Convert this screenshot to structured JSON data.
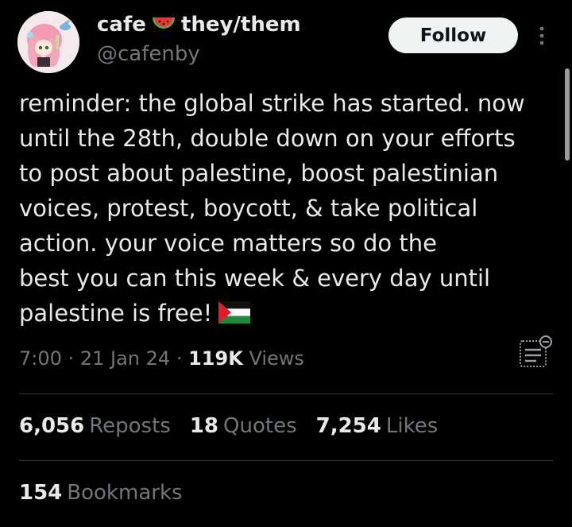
{
  "author": {
    "name": "cafe",
    "name_emoji": "watermelon-icon",
    "pronouns": "they/them",
    "handle": "@cafenby"
  },
  "follow_button": {
    "label": "Follow"
  },
  "tweet": {
    "lines": [
      "reminder: the global strike has started. now",
      "until the 28th, double down on your efforts",
      "to post about palestine, boost palestinian",
      "voices, protest, boycott, & take political",
      "action. your voice matters so do the",
      "best you can this week & every day until",
      "palestine is free!"
    ],
    "trailing_emoji": "palestine-flag-icon"
  },
  "meta": {
    "time": "7:00",
    "separator": "·",
    "date": "21 Jan 24",
    "views_count": "119K",
    "views_label": "Views"
  },
  "stats": {
    "reposts_count": "6,056",
    "reposts_label": "Reposts",
    "quotes_count": "18",
    "quotes_label": "Quotes",
    "likes_count": "7,254",
    "likes_label": "Likes",
    "bookmarks_count": "154",
    "bookmarks_label": "Bookmarks"
  },
  "colors": {
    "background": "#000000",
    "primary_text": "#e7e9ea",
    "secondary_text": "#71767b",
    "divider": "#2f3336",
    "follow_bg": "#eff3f4",
    "follow_text": "#0f1419"
  }
}
